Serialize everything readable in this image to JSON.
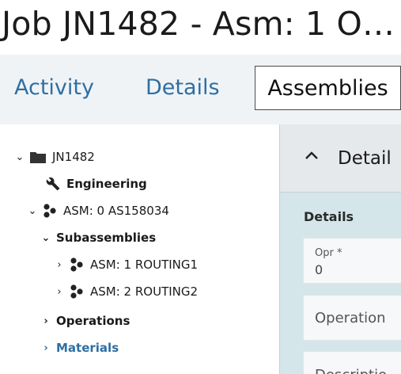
{
  "header": {
    "title": "Job JN1482 - Asm: 1 O…"
  },
  "tabs": [
    {
      "label": "Activity",
      "active": false
    },
    {
      "label": "Details",
      "active": false
    },
    {
      "label": "Assemblies",
      "active": true
    }
  ],
  "tree": {
    "root": {
      "label": "JN1482",
      "icon": "folder-icon",
      "expanded": true
    },
    "engineering": {
      "label": "Engineering",
      "icon": "wrench-icon"
    },
    "asm0": {
      "label": "ASM: 0 AS158034",
      "icon": "assembly-icon",
      "expanded": true
    },
    "subassemblies": {
      "label": "Subassemblies",
      "expanded": true
    },
    "asm1": {
      "label": "ASM: 1 ROUTING1",
      "icon": "assembly-icon",
      "expanded": false
    },
    "asm2": {
      "label": "ASM: 2 ROUTING2",
      "icon": "assembly-icon",
      "expanded": false
    },
    "operations": {
      "label": "Operations",
      "expanded": false
    },
    "materials": {
      "label": "Materials",
      "expanded": false
    }
  },
  "detail": {
    "title": "Detail",
    "section": "Details",
    "opr_label": "Opr *",
    "opr_value": "0",
    "operation_placeholder": "Operation",
    "description_placeholder": "Descriptio"
  },
  "colors": {
    "link": "#2d6fa3",
    "tabbar_bg": "#f0f3f6",
    "panel_bg": "#d5e6ea"
  }
}
